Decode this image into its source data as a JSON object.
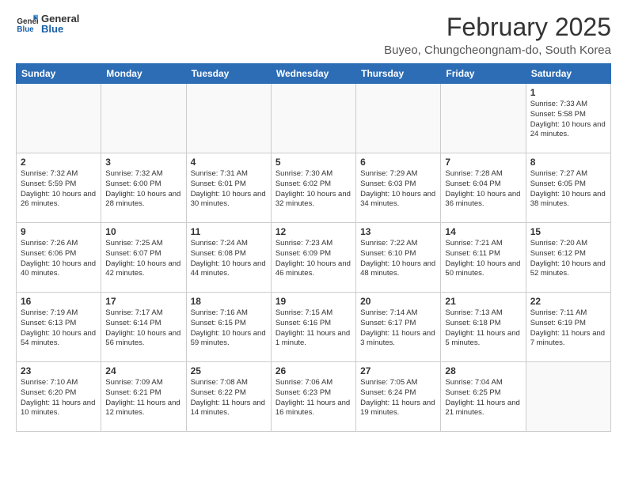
{
  "header": {
    "logo_general": "General",
    "logo_blue": "Blue",
    "month_title": "February 2025",
    "location": "Buyeo, Chungcheongnam-do, South Korea"
  },
  "days_of_week": [
    "Sunday",
    "Monday",
    "Tuesday",
    "Wednesday",
    "Thursday",
    "Friday",
    "Saturday"
  ],
  "weeks": [
    [
      {
        "day": "",
        "detail": ""
      },
      {
        "day": "",
        "detail": ""
      },
      {
        "day": "",
        "detail": ""
      },
      {
        "day": "",
        "detail": ""
      },
      {
        "day": "",
        "detail": ""
      },
      {
        "day": "",
        "detail": ""
      },
      {
        "day": "1",
        "detail": "Sunrise: 7:33 AM\nSunset: 5:58 PM\nDaylight: 10 hours and 24 minutes."
      }
    ],
    [
      {
        "day": "2",
        "detail": "Sunrise: 7:32 AM\nSunset: 5:59 PM\nDaylight: 10 hours and 26 minutes."
      },
      {
        "day": "3",
        "detail": "Sunrise: 7:32 AM\nSunset: 6:00 PM\nDaylight: 10 hours and 28 minutes."
      },
      {
        "day": "4",
        "detail": "Sunrise: 7:31 AM\nSunset: 6:01 PM\nDaylight: 10 hours and 30 minutes."
      },
      {
        "day": "5",
        "detail": "Sunrise: 7:30 AM\nSunset: 6:02 PM\nDaylight: 10 hours and 32 minutes."
      },
      {
        "day": "6",
        "detail": "Sunrise: 7:29 AM\nSunset: 6:03 PM\nDaylight: 10 hours and 34 minutes."
      },
      {
        "day": "7",
        "detail": "Sunrise: 7:28 AM\nSunset: 6:04 PM\nDaylight: 10 hours and 36 minutes."
      },
      {
        "day": "8",
        "detail": "Sunrise: 7:27 AM\nSunset: 6:05 PM\nDaylight: 10 hours and 38 minutes."
      }
    ],
    [
      {
        "day": "9",
        "detail": "Sunrise: 7:26 AM\nSunset: 6:06 PM\nDaylight: 10 hours and 40 minutes."
      },
      {
        "day": "10",
        "detail": "Sunrise: 7:25 AM\nSunset: 6:07 PM\nDaylight: 10 hours and 42 minutes."
      },
      {
        "day": "11",
        "detail": "Sunrise: 7:24 AM\nSunset: 6:08 PM\nDaylight: 10 hours and 44 minutes."
      },
      {
        "day": "12",
        "detail": "Sunrise: 7:23 AM\nSunset: 6:09 PM\nDaylight: 10 hours and 46 minutes."
      },
      {
        "day": "13",
        "detail": "Sunrise: 7:22 AM\nSunset: 6:10 PM\nDaylight: 10 hours and 48 minutes."
      },
      {
        "day": "14",
        "detail": "Sunrise: 7:21 AM\nSunset: 6:11 PM\nDaylight: 10 hours and 50 minutes."
      },
      {
        "day": "15",
        "detail": "Sunrise: 7:20 AM\nSunset: 6:12 PM\nDaylight: 10 hours and 52 minutes."
      }
    ],
    [
      {
        "day": "16",
        "detail": "Sunrise: 7:19 AM\nSunset: 6:13 PM\nDaylight: 10 hours and 54 minutes."
      },
      {
        "day": "17",
        "detail": "Sunrise: 7:17 AM\nSunset: 6:14 PM\nDaylight: 10 hours and 56 minutes."
      },
      {
        "day": "18",
        "detail": "Sunrise: 7:16 AM\nSunset: 6:15 PM\nDaylight: 10 hours and 59 minutes."
      },
      {
        "day": "19",
        "detail": "Sunrise: 7:15 AM\nSunset: 6:16 PM\nDaylight: 11 hours and 1 minute."
      },
      {
        "day": "20",
        "detail": "Sunrise: 7:14 AM\nSunset: 6:17 PM\nDaylight: 11 hours and 3 minutes."
      },
      {
        "day": "21",
        "detail": "Sunrise: 7:13 AM\nSunset: 6:18 PM\nDaylight: 11 hours and 5 minutes."
      },
      {
        "day": "22",
        "detail": "Sunrise: 7:11 AM\nSunset: 6:19 PM\nDaylight: 11 hours and 7 minutes."
      }
    ],
    [
      {
        "day": "23",
        "detail": "Sunrise: 7:10 AM\nSunset: 6:20 PM\nDaylight: 11 hours and 10 minutes."
      },
      {
        "day": "24",
        "detail": "Sunrise: 7:09 AM\nSunset: 6:21 PM\nDaylight: 11 hours and 12 minutes."
      },
      {
        "day": "25",
        "detail": "Sunrise: 7:08 AM\nSunset: 6:22 PM\nDaylight: 11 hours and 14 minutes."
      },
      {
        "day": "26",
        "detail": "Sunrise: 7:06 AM\nSunset: 6:23 PM\nDaylight: 11 hours and 16 minutes."
      },
      {
        "day": "27",
        "detail": "Sunrise: 7:05 AM\nSunset: 6:24 PM\nDaylight: 11 hours and 19 minutes."
      },
      {
        "day": "28",
        "detail": "Sunrise: 7:04 AM\nSunset: 6:25 PM\nDaylight: 11 hours and 21 minutes."
      },
      {
        "day": "",
        "detail": ""
      }
    ]
  ]
}
